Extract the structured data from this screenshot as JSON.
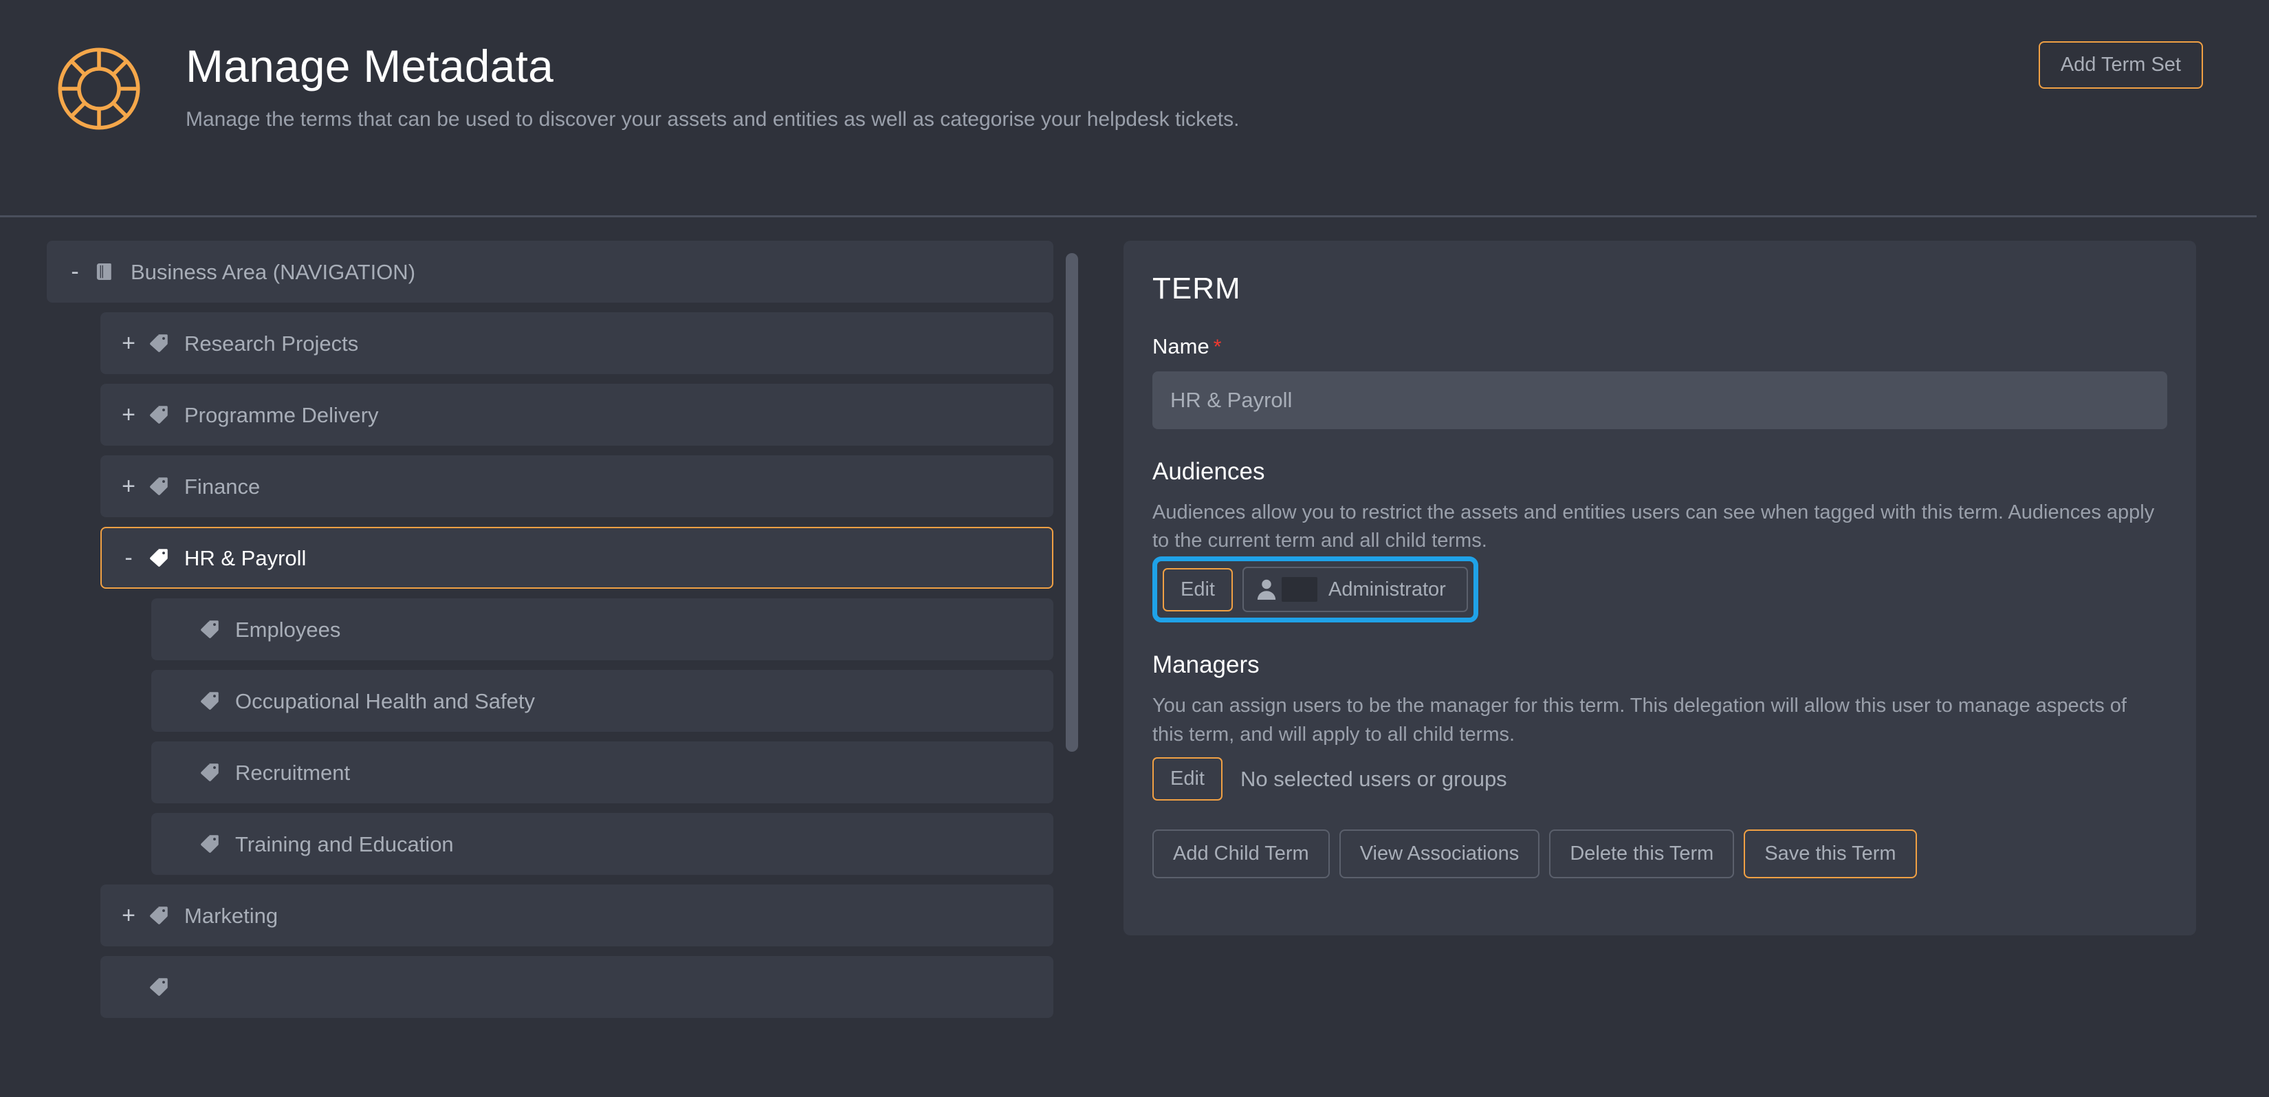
{
  "header": {
    "logo_icon": "lifebuoy-icon",
    "title": "Manage Metadata",
    "subtitle": "Manage the terms that can be used to discover your assets and entities as well as categorise your helpdesk tickets.",
    "add_term_set_label": "Add Term Set"
  },
  "tree": {
    "items": [
      {
        "label": "Business Area (NAVIGATION)",
        "toggle": "-",
        "icon": "book-icon",
        "depth": 0,
        "selected": false
      },
      {
        "label": "Research Projects",
        "toggle": "+",
        "icon": "tag-icon",
        "depth": 1,
        "selected": false
      },
      {
        "label": "Programme Delivery",
        "toggle": "+",
        "icon": "tag-icon",
        "depth": 1,
        "selected": false
      },
      {
        "label": "Finance",
        "toggle": "+",
        "icon": "tag-icon",
        "depth": 1,
        "selected": false
      },
      {
        "label": "HR & Payroll",
        "toggle": "-",
        "icon": "tag-icon",
        "depth": 1,
        "selected": true
      },
      {
        "label": "Employees",
        "toggle": "",
        "icon": "tag-icon",
        "depth": 2,
        "selected": false
      },
      {
        "label": "Occupational Health and Safety",
        "toggle": "",
        "icon": "tag-icon",
        "depth": 2,
        "selected": false
      },
      {
        "label": "Recruitment",
        "toggle": "",
        "icon": "tag-icon",
        "depth": 2,
        "selected": false
      },
      {
        "label": "Training and Education",
        "toggle": "",
        "icon": "tag-icon",
        "depth": 2,
        "selected": false
      },
      {
        "label": "Marketing",
        "toggle": "+",
        "icon": "tag-icon",
        "depth": 1,
        "selected": false
      },
      {
        "label": "",
        "toggle": "",
        "icon": "tag-icon",
        "depth": 1,
        "selected": false
      }
    ]
  },
  "term_panel": {
    "heading": "TERM",
    "name_label": "Name",
    "name_required_marker": "*",
    "name_value": "HR & Payroll",
    "audiences": {
      "title": "Audiences",
      "description": "Audiences allow you to restrict the assets and entities users can see when tagged with this term. Audiences apply to the current term and all child terms.",
      "edit_label": "Edit",
      "selected_user": "Administrator",
      "user_icon": "user-icon"
    },
    "managers": {
      "title": "Managers",
      "description": "You can assign users to be the manager for this term. This delegation will allow this user to manage aspects of this term, and will apply to all child terms.",
      "edit_label": "Edit",
      "empty_text": "No selected users or groups"
    },
    "actions": [
      {
        "label": "Add Child Term",
        "primary": false
      },
      {
        "label": "View Associations",
        "primary": false
      },
      {
        "label": "Delete this Term",
        "primary": false
      },
      {
        "label": "Save this Term",
        "primary": true
      }
    ]
  },
  "colors": {
    "background": "#2f323b",
    "panel": "#383c47",
    "accent_orange": "#f0a044",
    "focus_blue": "#1fa2e8",
    "required_red": "#f4392f",
    "text_muted": "#9aa0ab"
  }
}
